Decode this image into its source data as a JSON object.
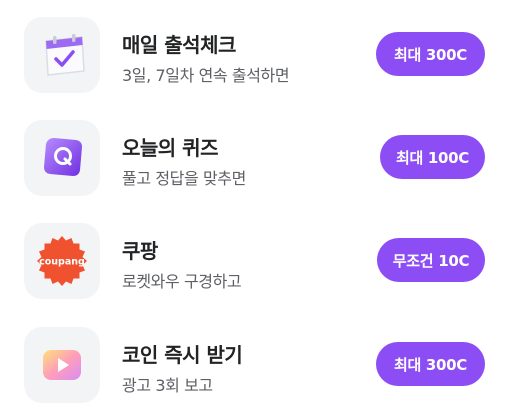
{
  "missions": [
    {
      "title": "매일 출석체크",
      "subtitle": "3일, 7일차 연속 출석하면",
      "reward": "최대 300C",
      "icon": "calendar-check-icon"
    },
    {
      "title": "오늘의 퀴즈",
      "subtitle": "풀고 정답을 맞추면",
      "reward": "최대 100C",
      "icon": "quiz-q-icon"
    },
    {
      "title": "쿠팡",
      "subtitle": "로켓와우 구경하고",
      "reward": "무조건 10C",
      "icon": "coupang-logo-icon",
      "logo_text": "coupang"
    },
    {
      "title": "코인 즉시 받기",
      "subtitle": "광고 3회 보고",
      "reward": "최대 300C",
      "icon": "video-play-icon"
    }
  ],
  "colors": {
    "accent": "#8c4df5",
    "title": "#222325",
    "subtitle": "#5e6066",
    "icon_bg": "#f3f4f6"
  }
}
